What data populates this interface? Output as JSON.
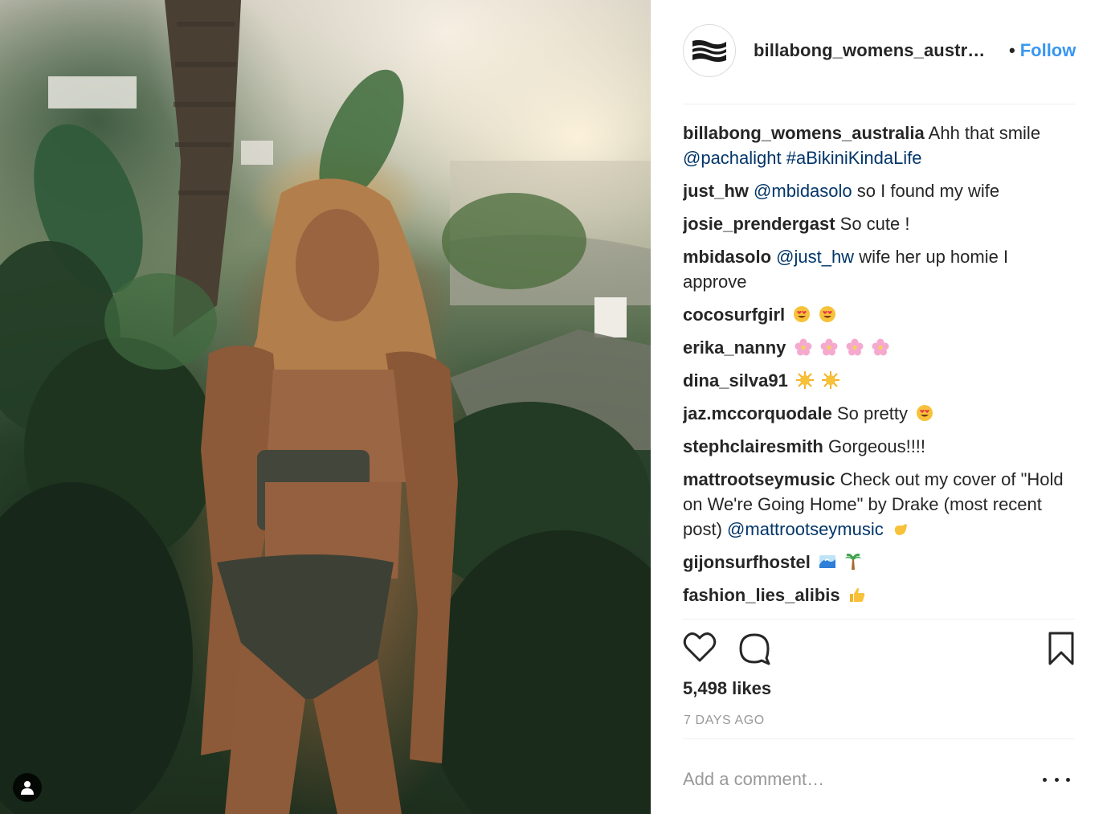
{
  "post": {
    "author": "billabong_womens_austr…",
    "follow_separator": "•",
    "follow_label": "Follow",
    "caption": {
      "user": "billabong_womens_australia",
      "text_before": "Ahh that smile",
      "mention": "@pachalight",
      "hashtag": "#aBikiniKindaLife"
    },
    "comments": [
      {
        "user": "just_hw",
        "mention": "@mbidasolo",
        "text": "so I found my wife"
      },
      {
        "user": "josie_prendergast",
        "text": "So cute !"
      },
      {
        "user": "mbidasolo",
        "mention": "@just_hw",
        "text": "wife her up homie I approve"
      },
      {
        "user": "cocosurfgirl",
        "emoji": [
          "heart-eyes-emoji",
          "heart-eyes-emoji"
        ]
      },
      {
        "user": "erika_nanny",
        "emoji": [
          "blossom-emoji",
          "blossom-emoji",
          "blossom-emoji",
          "blossom-emoji"
        ]
      },
      {
        "user": "dina_silva91",
        "emoji": [
          "sun-emoji",
          "sun-emoji"
        ]
      },
      {
        "user": "jaz.mccorquodale",
        "text": "So pretty",
        "emoji": [
          "heart-eyes-emoji"
        ]
      },
      {
        "user": "stephclairesmith",
        "text": "Gorgeous!!!!"
      },
      {
        "user": "mattrootseymusic",
        "text": "Check out my cover of \"Hold on We're Going Home\" by Drake (most recent post)",
        "mention": "@mattrootseymusic",
        "emoji": [
          "call-me-hand-emoji"
        ]
      },
      {
        "user": "gijonsurfhostel",
        "emoji": [
          "wave-emoji",
          "palm-tree-emoji"
        ]
      },
      {
        "user": "fashion_lies_alibis",
        "emoji": [
          "thumbs-up-emoji"
        ]
      }
    ],
    "likes": "5,498 likes",
    "time_ago": "7 DAYS AGO",
    "add_comment_placeholder": "Add a comment…"
  },
  "icons": {
    "like": "heart-outline-icon",
    "comment": "speech-bubble-icon",
    "save": "bookmark-icon",
    "more": "ellipsis-icon",
    "user_tag": "person-icon",
    "logo": "billabong-logo"
  },
  "colors": {
    "link": "#003569",
    "follow": "#3897f0",
    "text": "#262626",
    "muted": "#999999"
  }
}
